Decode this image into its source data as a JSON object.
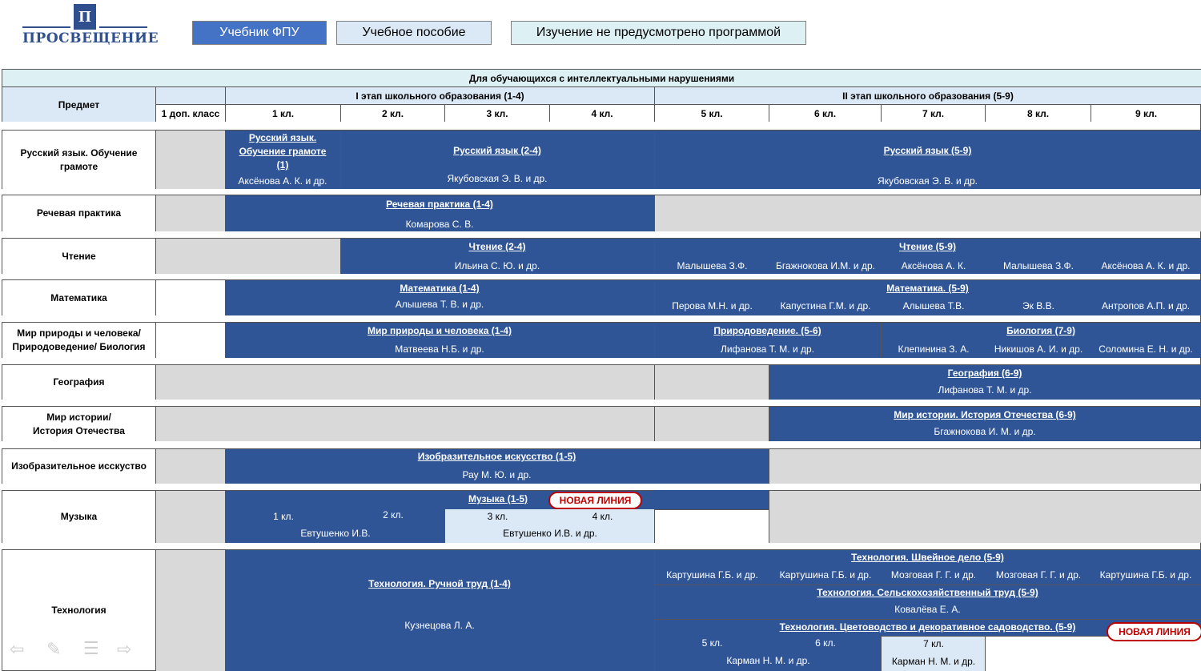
{
  "logo": {
    "text": "ПРОСВЕЩЕНИЕ",
    "mark": "П"
  },
  "legend": [
    {
      "label": "Учебник ФПУ",
      "color": "#4472c4"
    },
    {
      "label": "Учебное пособие",
      "color": "#dbe8f5"
    },
    {
      "label": "Изучение не предусмотрено программой",
      "color": "#ddf0f4"
    }
  ],
  "header": {
    "title": "Для обучающихся с интеллектуальными нарушениями",
    "subject": "Предмет",
    "stage1": "I этап школьного образования (1-4)",
    "stage2": "II этап школьного образования (5-9)",
    "grades": [
      "1 доп. класс",
      "1 кл.",
      "2 кл.",
      "3 кл.",
      "4 кл.",
      "5 кл.",
      "6 кл.",
      "7 кл.",
      "8 кл.",
      "9 кл."
    ]
  },
  "rows": {
    "russian": {
      "label": "Русский язык. Обучение грамоте",
      "b1_title_l1": "Русский язык.",
      "b1_title_l2": "Обучение грамоте",
      "b1_title_l3": "(1)",
      "b1_author": "Аксёнова А. К. и др.",
      "b2_title": "Русский язык (2-4)",
      "b2_author": "Якубовская Э. В. и др.",
      "b3_title": "Русский язык (5-9)",
      "b3_author": "Якубовская Э. В. и др."
    },
    "speech": {
      "label": "Речевая практика",
      "title": "Речевая практика (1-4)",
      "author": "Комарова С. В."
    },
    "reading": {
      "label": "Чтение",
      "b1_title": "Чтение (2-4)",
      "b1_author": "Ильина С. Ю. и др.",
      "b2_title": "Чтение (5-9)",
      "authors": [
        "Малышева З.Ф.",
        "Бгажнокова И.М. и др.",
        "Аксёнова А. К.",
        "Малышева З.Ф.",
        "Аксёнова А. К. и др."
      ]
    },
    "math": {
      "label": "Математика",
      "b1_title": "Математика (1-4)",
      "b1_author": "Алышева Т. В. и др.",
      "b2_title": "Математика. (5-9)",
      "authors": [
        "Перова М.Н. и др.",
        "Капустина Г.М. и др.",
        "Алышева Т.В.",
        "Эк В.В.",
        "Антропов А.П. и др."
      ]
    },
    "nature": {
      "label_l1": "Мир природы и человека/",
      "label_l2": "Природоведение/ Биология",
      "b1_title": "Мир природы и человека (1-4)",
      "b1_author": "Матвеева Н.Б. и др.",
      "b2_title": "Природоведение. (5-6)",
      "b2_author": "Лифанова Т. М. и др.",
      "b3_title": "Биология (7-9)",
      "authors": [
        "Клепинина З. А.",
        "Никишов А. И. и др.",
        "Соломина Е. Н. и др."
      ]
    },
    "geography": {
      "label": "География",
      "title": "География (6-9)",
      "author": "Лифанова Т. М. и др."
    },
    "history": {
      "label_l1": "Мир истории/",
      "label_l2": "История Отечества",
      "title": "Мир истории. История Отечества (6-9)",
      "author": "Бгажнокова И. М. и др."
    },
    "art": {
      "label": "Изобразительное исскуство",
      "title": "Изобразительное искусство (1-5)",
      "author": "Рау М. Ю. и др."
    },
    "music": {
      "label": "Музыка",
      "title": "Музыка (1-5)",
      "badge": "НОВАЯ ЛИНИЯ",
      "g1": "1 кл.",
      "g2": "2 кл.",
      "g3": "3 кл.",
      "g4": "4 кл.",
      "author1": "Евтушенко И.В.",
      "author2": "Евтушенко И.В. и др."
    },
    "tech": {
      "label": "Технология",
      "b1_title": "Технология. Ручной труд (1-4)",
      "b1_author": "Кузнецова Л. А.",
      "sew_title": "Технология. Швейное дело (5-9)",
      "sew_authors": [
        "Картушина Г.Б. и др.",
        "Картушина Г.Б. и др.",
        "Мозговая Г. Г. и др.",
        "Мозговая Г. Г. и др.",
        "Картушина Г.Б. и др."
      ],
      "agri_title": "Технология. Сельскохозяйственный труд (5-9)",
      "agri_author": "Ковалёва Е. А.",
      "flower_title": "Технология. Цветоводство и декоративное садоводство. (5-9)",
      "flower_badge": "НОВАЯ ЛИНИЯ",
      "fg5": "5 кл.",
      "fg6": "6 кл.",
      "fg7": "7 кл.",
      "flower_author1": "Карман Н. М. и др.",
      "flower_author2": "Карман Н. М. и др."
    }
  },
  "nav": [
    "arrow-left-icon",
    "pencil-icon",
    "menu-icon",
    "arrow-right-icon"
  ]
}
